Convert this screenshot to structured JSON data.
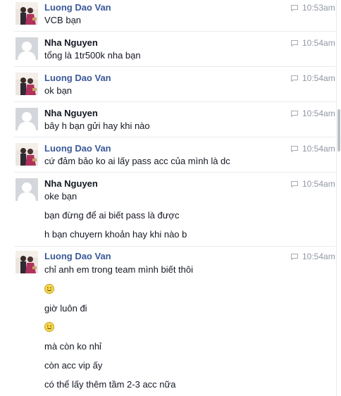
{
  "conversation": {
    "groups": [
      {
        "sender": "Luong Dao Van",
        "avatar": "profile-photo",
        "time": "10:53am",
        "messages": [
          "VCB bạn"
        ]
      },
      {
        "sender": "Nha Nguyen",
        "avatar": "default-silhouette",
        "time": "10:54am",
        "messages": [
          "tổng là 1tr500k nha bạn"
        ]
      },
      {
        "sender": "Luong Dao Van",
        "avatar": "profile-photo",
        "time": "10:54am",
        "messages": [
          "ok bạn"
        ]
      },
      {
        "sender": "Nha Nguyen",
        "avatar": "default-silhouette",
        "time": "10:54am",
        "messages": [
          "bây h bạn gửi hay khi nào"
        ]
      },
      {
        "sender": "Luong Dao Van",
        "avatar": "profile-photo",
        "time": "10:54am",
        "messages": [
          "cứ đảm bảo ko ai lấy pass acc của mình là dc"
        ]
      },
      {
        "sender": "Nha Nguyen",
        "avatar": "default-silhouette",
        "time": "10:54am",
        "messages": [
          "oke bạn",
          "bạn đừng để ai biết pass là được",
          "h bạn chuyern khoản hay khi nào b"
        ]
      },
      {
        "sender": "Luong Dao Van",
        "avatar": "profile-photo",
        "time": "10:54am",
        "messages": [
          "chỉ anh em trong team mình biết thôi",
          "smiley-emoji",
          "giờ luôn đi",
          "smiley-emoji",
          "mà còn ko nhỉ",
          "còn acc vip ấy",
          "có thể lấy thêm tầm 2-3 acc nữa"
        ]
      }
    ]
  },
  "colors": {
    "sender_luong": "#3b5998",
    "sender_nha": "#141823",
    "timestamp": "#9197a3",
    "divider": "#e9ebee"
  },
  "icons": {
    "timestamp": "chat-bubble-icon",
    "emoji": "smiley-icon"
  }
}
